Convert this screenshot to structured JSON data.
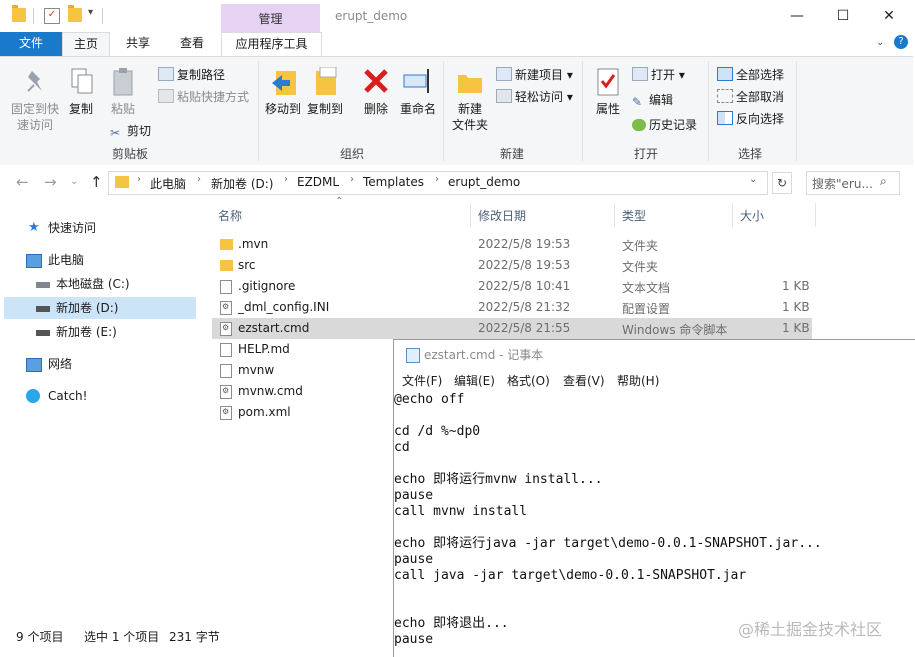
{
  "titlebar": {
    "title": "erupt_demo",
    "context_group": "管理",
    "minimize": "—",
    "maximize": "☐",
    "close": "✕"
  },
  "ribbon_tabs": {
    "file": "文件",
    "home": "主页",
    "share": "共享",
    "view": "查看",
    "app_tools": "应用程序工具"
  },
  "ribbon": {
    "clipboard": {
      "pin": "固定到快\n速访问",
      "copy": "复制",
      "paste": "粘贴",
      "copy_path": "复制路径",
      "paste_shortcut": "粘贴快捷方式",
      "cut": "剪切",
      "group": "剪贴板"
    },
    "organize": {
      "move_to": "移动到",
      "copy_to": "复制到",
      "delete": "删除",
      "rename": "重命名",
      "group": "组织"
    },
    "new": {
      "new_folder": "新建\n文件夹",
      "new_item": "新建项目",
      "easy_access": "轻松访问",
      "group": "新建"
    },
    "open": {
      "properties": "属性",
      "open": "打开",
      "edit": "编辑",
      "history": "历史记录",
      "group": "打开"
    },
    "select": {
      "select_all": "全部选择",
      "select_none": "全部取消",
      "invert": "反向选择",
      "group": "选择"
    }
  },
  "address": {
    "crumbs": [
      "此电脑",
      "新加卷 (D:)",
      "EZDML",
      "Templates",
      "erupt_demo"
    ],
    "search_placeholder": "搜索\"eru..."
  },
  "nav": {
    "items": [
      {
        "label": "快速访问"
      },
      {
        "label": "此电脑"
      },
      {
        "label": "本地磁盘 (C:)"
      },
      {
        "label": "新加卷 (D:)"
      },
      {
        "label": "新加卷 (E:)"
      },
      {
        "label": "网络"
      },
      {
        "label": "Catch!"
      }
    ]
  },
  "columns": {
    "name": "名称",
    "date": "修改日期",
    "type": "类型",
    "size": "大小"
  },
  "files": [
    {
      "name": ".mvn",
      "date": "2022/5/8 19:53",
      "type": "文件夹",
      "size": "",
      "icon": "folder"
    },
    {
      "name": "src",
      "date": "2022/5/8 19:53",
      "type": "文件夹",
      "size": "",
      "icon": "folder"
    },
    {
      "name": ".gitignore",
      "date": "2022/5/8 10:41",
      "type": "文本文档",
      "size": "1 KB",
      "icon": "doc"
    },
    {
      "name": "_dml_config.INI",
      "date": "2022/5/8 21:32",
      "type": "配置设置",
      "size": "1 KB",
      "icon": "cmd"
    },
    {
      "name": "ezstart.cmd",
      "date": "2022/5/8 21:55",
      "type": "Windows 命令脚本",
      "size": "1 KB",
      "icon": "cmd"
    },
    {
      "name": "HELP.md",
      "date": "",
      "type": "",
      "size": "",
      "icon": "doc"
    },
    {
      "name": "mvnw",
      "date": "",
      "type": "",
      "size": "",
      "icon": "doc"
    },
    {
      "name": "mvnw.cmd",
      "date": "",
      "type": "",
      "size": "",
      "icon": "cmd"
    },
    {
      "name": "pom.xml",
      "date": "",
      "type": "",
      "size": "",
      "icon": "cmd"
    }
  ],
  "status": {
    "count": "9 个项目",
    "selected": "选中 1 个项目",
    "bytes": "231 字节"
  },
  "notepad": {
    "title": "ezstart.cmd - 记事本",
    "menus": [
      "文件(F)",
      "编辑(E)",
      "格式(O)",
      "查看(V)",
      "帮助(H)"
    ],
    "content": "@echo off\n\ncd /d %~dp0\ncd\n\necho 即将运行mvnw install...\npause\ncall mvnw install\n\necho 即将运行java -jar target\\demo-0.0.1-SNAPSHOT.jar...\npause\ncall java -jar target\\demo-0.0.1-SNAPSHOT.jar\n\n\necho 即将退出...\npause"
  },
  "watermark": "@稀土掘金技术社区"
}
